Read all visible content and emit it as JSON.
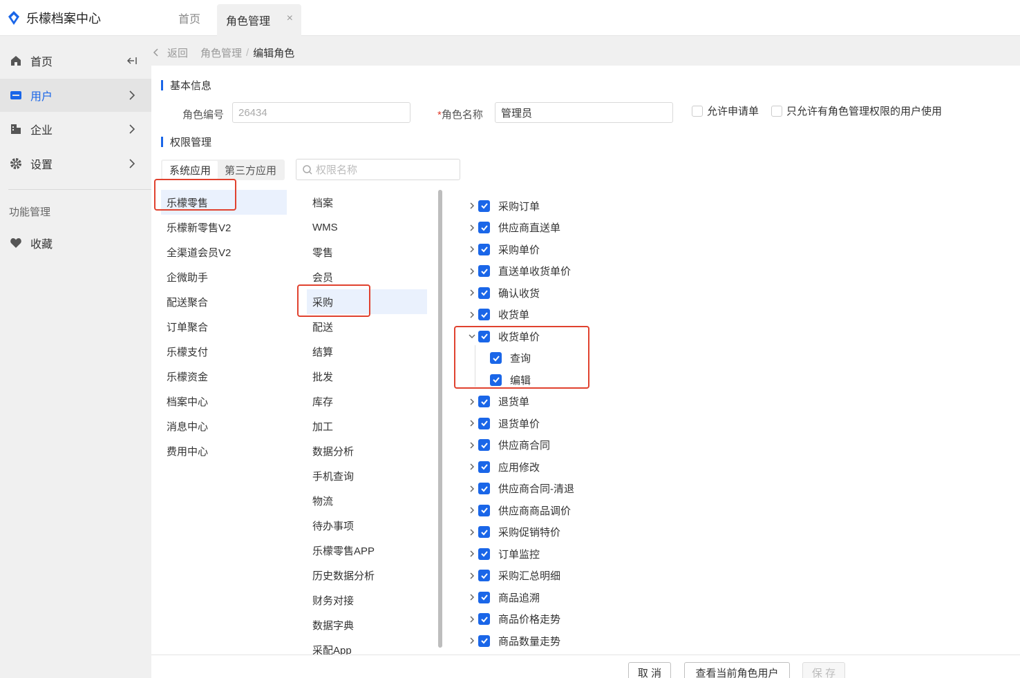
{
  "app": {
    "title": "乐檬档案中心",
    "brand_color": "#1a66e8"
  },
  "tabs": {
    "home": "首页",
    "role": "角色管理",
    "close": "×"
  },
  "sidebar": {
    "items": [
      {
        "label": "首页",
        "icon": "home-icon"
      },
      {
        "label": "用户",
        "icon": "user-icon",
        "active": true
      },
      {
        "label": "企业",
        "icon": "building-icon"
      },
      {
        "label": "设置",
        "icon": "gear-icon"
      }
    ],
    "group_label": "功能管理",
    "favorite_label": "收藏"
  },
  "breadcrumb": {
    "back": "返回",
    "parent": "角色管理",
    "separator": "/",
    "current": "编辑角色"
  },
  "basic": {
    "title": "基本信息",
    "code_label": "角色编号",
    "code_value": "26434",
    "name_required": "*",
    "name_label": "角色名称",
    "name_value": "管理员",
    "allow_apply": "允许申请单",
    "only_role_admin": "只允许有角色管理权限的用户使用"
  },
  "perm": {
    "title": "权限管理",
    "seg_system": "系统应用",
    "seg_third": "第三方应用",
    "search_placeholder": "权限名称",
    "apps": [
      "乐檬零售",
      "乐檬新零售V2",
      "全渠道会员V2",
      "企微助手",
      "配送聚合",
      "订单聚合",
      "乐檬支付",
      "乐檬资金",
      "档案中心",
      "消息中心",
      "费用中心"
    ],
    "modules": [
      "档案",
      "WMS",
      "零售",
      "会员",
      "采购",
      "配送",
      "结算",
      "批发",
      "库存",
      "加工",
      "数据分析",
      "手机查询",
      "物流",
      "待办事项",
      "乐檬零售APP",
      "历史数据分析",
      "财务对接",
      "数据字典",
      "采配App"
    ],
    "items": [
      {
        "label": "采购订单",
        "level": 0,
        "expanded": false
      },
      {
        "label": "供应商直送单",
        "level": 0,
        "expanded": false
      },
      {
        "label": "采购单价",
        "level": 0,
        "expanded": false
      },
      {
        "label": "直送单收货单价",
        "level": 0,
        "expanded": false
      },
      {
        "label": "确认收货",
        "level": 0,
        "expanded": false
      },
      {
        "label": "收货单",
        "level": 0,
        "expanded": false
      },
      {
        "label": "收货单价",
        "level": 0,
        "expanded": true
      },
      {
        "label": "查询",
        "level": 1
      },
      {
        "label": "编辑",
        "level": 1
      },
      {
        "label": "退货单",
        "level": 0,
        "expanded": false
      },
      {
        "label": "退货单价",
        "level": 0,
        "expanded": false
      },
      {
        "label": "供应商合同",
        "level": 0,
        "expanded": false
      },
      {
        "label": "应用修改",
        "level": 0,
        "expanded": false
      },
      {
        "label": "供应商合同-清退",
        "level": 0,
        "expanded": false
      },
      {
        "label": "供应商商品调价",
        "level": 0,
        "expanded": false
      },
      {
        "label": "采购促销特价",
        "level": 0,
        "expanded": false
      },
      {
        "label": "订单监控",
        "level": 0,
        "expanded": false
      },
      {
        "label": "采购汇总明细",
        "level": 0,
        "expanded": false
      },
      {
        "label": "商品追溯",
        "level": 0,
        "expanded": false
      },
      {
        "label": "商品价格走势",
        "level": 0,
        "expanded": false
      },
      {
        "label": "商品数量走势",
        "level": 0,
        "expanded": false
      }
    ]
  },
  "footer": {
    "cancel": "取 消",
    "view_users": "查看当前角色用户",
    "save": "保 存"
  }
}
